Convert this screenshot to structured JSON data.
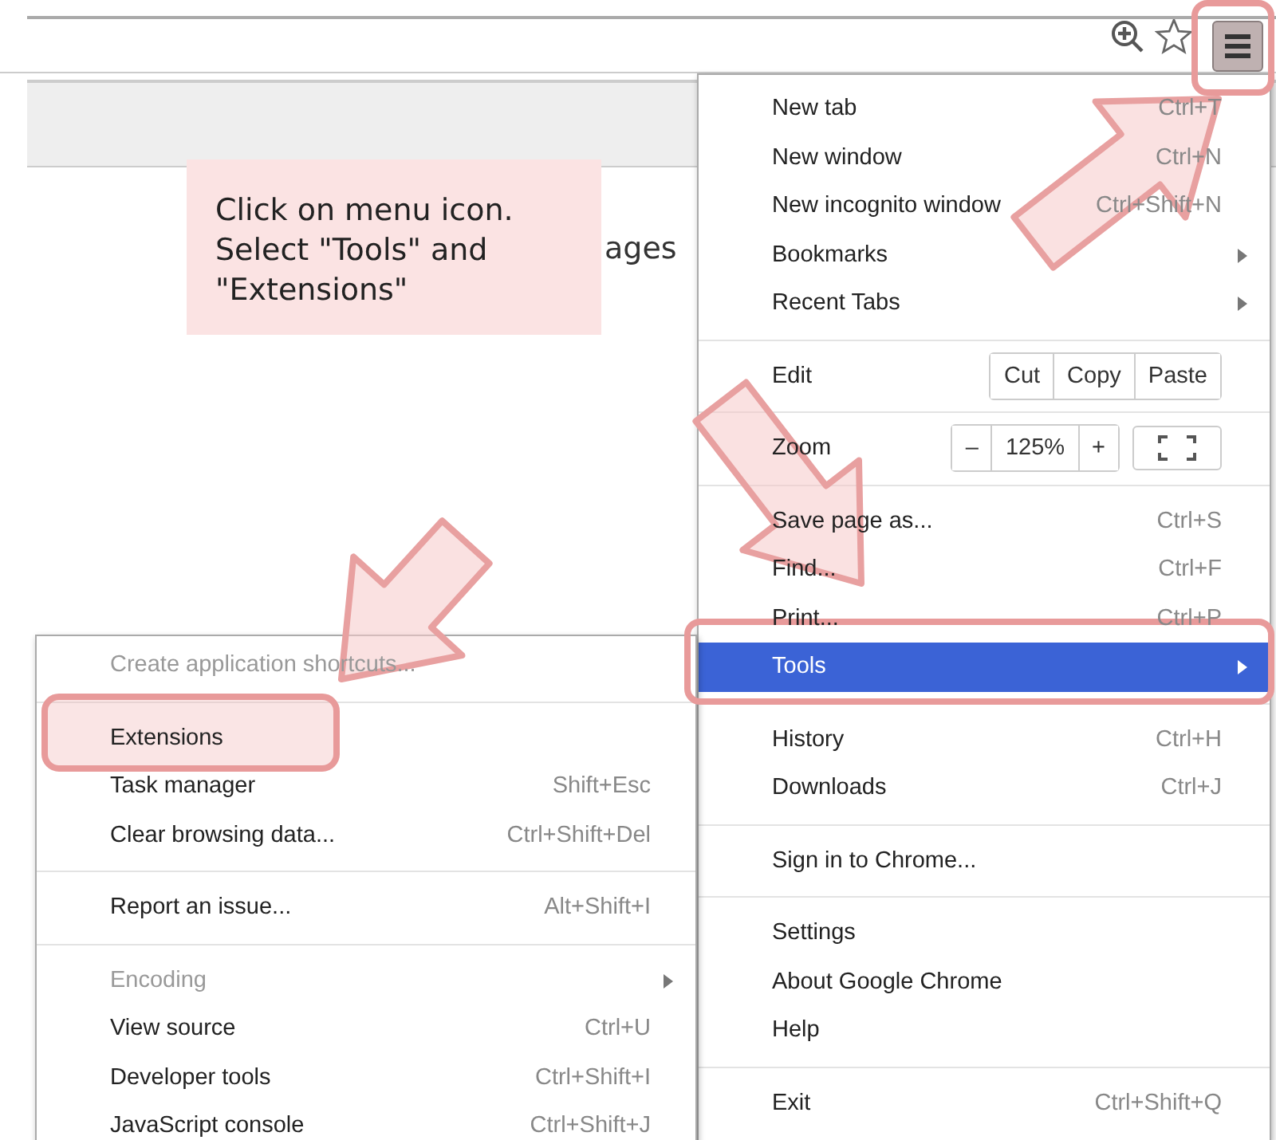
{
  "page": {
    "text": "ages"
  },
  "callout": {
    "lines": [
      "Click on menu icon.",
      "Select \"Tools\" and",
      "\"Extensions\""
    ]
  },
  "main_menu": {
    "items": [
      {
        "kind": "item",
        "label": "New tab",
        "shortcut": "Ctrl+T",
        "submenu": false,
        "disabled": false,
        "selected": false
      },
      {
        "kind": "item",
        "label": "New window",
        "shortcut": "Ctrl+N",
        "submenu": false,
        "disabled": false,
        "selected": false
      },
      {
        "kind": "item",
        "label": "New incognito window",
        "shortcut": "Ctrl+Shift+N",
        "submenu": false,
        "disabled": false,
        "selected": false
      },
      {
        "kind": "item",
        "label": "Bookmarks",
        "submenu": true,
        "disabled": false,
        "selected": false
      },
      {
        "kind": "item",
        "label": "Recent Tabs",
        "submenu": true,
        "disabled": false,
        "selected": false
      },
      {
        "kind": "separator"
      },
      {
        "kind": "edit",
        "label": "Edit",
        "buttons": [
          "Cut",
          "Copy",
          "Paste"
        ]
      },
      {
        "kind": "separator"
      },
      {
        "kind": "zoom",
        "label": "Zoom",
        "minus": "–",
        "value": "125%",
        "plus": "+"
      },
      {
        "kind": "separator"
      },
      {
        "kind": "item",
        "label": "Save page as...",
        "shortcut": "Ctrl+S",
        "submenu": false,
        "disabled": false,
        "selected": false
      },
      {
        "kind": "item",
        "label": "Find...",
        "shortcut": "Ctrl+F",
        "submenu": false,
        "disabled": false,
        "selected": false
      },
      {
        "kind": "item",
        "label": "Print...",
        "shortcut": "Ctrl+P",
        "submenu": false,
        "disabled": false,
        "selected": false
      },
      {
        "kind": "item",
        "label": "Tools",
        "submenu": true,
        "disabled": false,
        "selected": true
      },
      {
        "kind": "separator"
      },
      {
        "kind": "item",
        "label": "History",
        "shortcut": "Ctrl+H",
        "submenu": false,
        "disabled": false,
        "selected": false
      },
      {
        "kind": "item",
        "label": "Downloads",
        "shortcut": "Ctrl+J",
        "submenu": false,
        "disabled": false,
        "selected": false
      },
      {
        "kind": "separator"
      },
      {
        "kind": "item",
        "label": "Sign in to Chrome...",
        "submenu": false,
        "disabled": false,
        "selected": false
      },
      {
        "kind": "separator"
      },
      {
        "kind": "item",
        "label": "Settings",
        "submenu": false,
        "disabled": false,
        "selected": false
      },
      {
        "kind": "item",
        "label": "About Google Chrome",
        "submenu": false,
        "disabled": false,
        "selected": false
      },
      {
        "kind": "item",
        "label": "Help",
        "submenu": false,
        "disabled": false,
        "selected": false
      },
      {
        "kind": "separator"
      },
      {
        "kind": "item",
        "label": "Exit",
        "shortcut": "Ctrl+Shift+Q",
        "submenu": false,
        "disabled": false,
        "selected": false
      }
    ]
  },
  "tools_submenu": {
    "items": [
      {
        "kind": "item",
        "label": "Create application shortcuts...",
        "submenu": false,
        "disabled": true,
        "selected": false
      },
      {
        "kind": "separator"
      },
      {
        "kind": "item",
        "label": "Extensions",
        "submenu": false,
        "disabled": false,
        "selected": false
      },
      {
        "kind": "item",
        "label": "Task manager",
        "shortcut": "Shift+Esc",
        "submenu": false,
        "disabled": false,
        "selected": false
      },
      {
        "kind": "item",
        "label": "Clear browsing data...",
        "shortcut": "Ctrl+Shift+Del",
        "submenu": false,
        "disabled": false,
        "selected": false
      },
      {
        "kind": "separator"
      },
      {
        "kind": "item",
        "label": "Report an issue...",
        "shortcut": "Alt+Shift+I",
        "submenu": false,
        "disabled": false,
        "selected": false
      },
      {
        "kind": "separator"
      },
      {
        "kind": "item",
        "label": "Encoding",
        "submenu": true,
        "disabled": true,
        "selected": false
      },
      {
        "kind": "item",
        "label": "View source",
        "shortcut": "Ctrl+U",
        "submenu": false,
        "disabled": false,
        "selected": false
      },
      {
        "kind": "item",
        "label": "Developer tools",
        "shortcut": "Ctrl+Shift+I",
        "submenu": false,
        "disabled": false,
        "selected": false
      },
      {
        "kind": "item",
        "label": "JavaScript console",
        "shortcut": "Ctrl+Shift+J",
        "submenu": false,
        "disabled": false,
        "selected": false
      }
    ]
  }
}
